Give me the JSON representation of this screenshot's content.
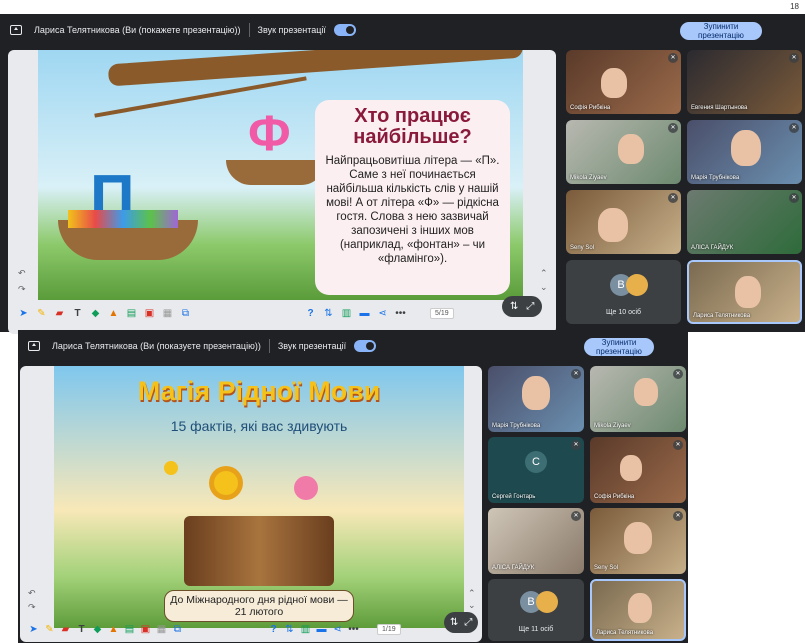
{
  "w1": {
    "header": {
      "presenter": "Лариса Телятникова (Ви (покажете презентацію))",
      "sound": "Звук презентації",
      "stop": "Зупинити презентацію"
    },
    "slide": {
      "title": "Хто працює найбільше?",
      "text": "Найпрацьовитіша літера — «П». Саме з неї починається найбільша кількість слів у нашій мові! А от літера «Ф» — рідкісна гостя. Слова з нею зазвичай запозичені з інших мов (наприклад, «фонтан» – чи «фламінго»).",
      "letter_left": "П",
      "letter_right": "Ф"
    },
    "page": "5/19",
    "tiles": [
      "Софія Рибкіна",
      "Евгения Шартынова",
      "Mikola Ziyaev",
      "Марія Трубнікова",
      "Seny Sol",
      "АЛІСА ГАЙДУК",
      "Ще 10 осіб",
      "Лариса Телятникова"
    ],
    "avatar_b": "В"
  },
  "w2": {
    "header": {
      "presenter": "Лариса Телятникова (Ви (показуєте презентацію))",
      "sound": "Звук презентації",
      "stop": "Зупинити презентацію"
    },
    "slide": {
      "title": "Магія Рідної Мови",
      "subtitle": "15 фактів, які вас здивують",
      "banner": "До Міжнародного дня рідної мови — 21 лютого"
    },
    "page": "1/19",
    "tiles": [
      "Марія Трубнікова",
      "Mikola Ziyaev",
      "Сергей Гонтарь",
      "Софія Рибкіна",
      "АЛІСА ГАЙДУК",
      "Seny Sol",
      "Ще 11 осіб",
      "Лариса Телятникова"
    ],
    "avatar_c": "С",
    "avatar_b": "В"
  },
  "corner_count": "18",
  "toolbar_more": "•••",
  "help": "?"
}
